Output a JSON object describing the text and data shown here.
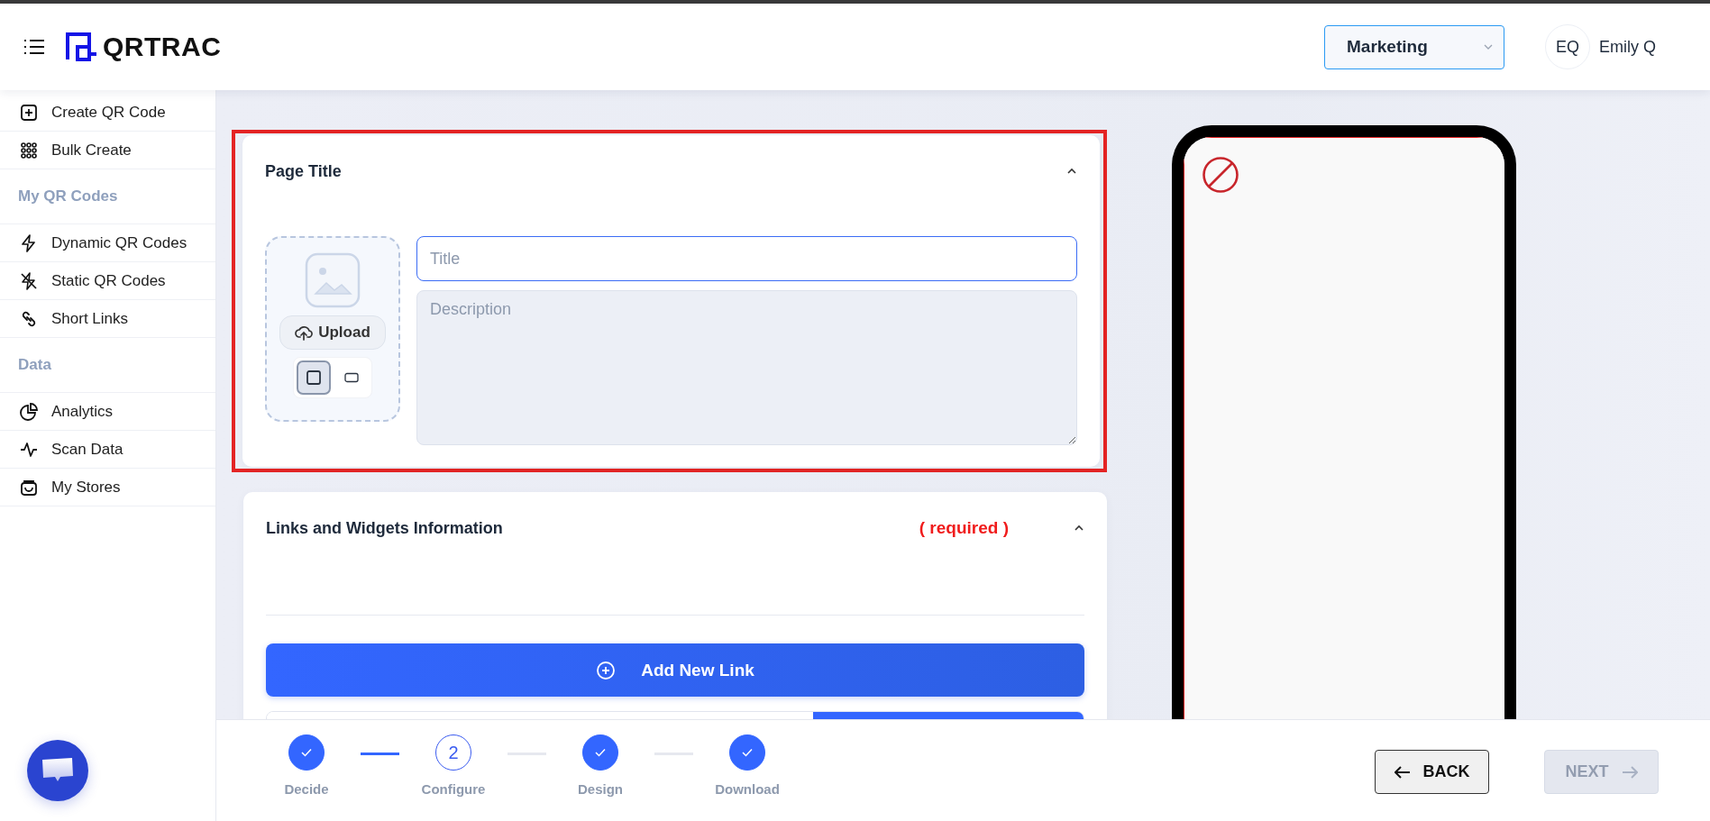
{
  "header": {
    "brand": "QRTRAC",
    "team_select": {
      "value": "Marketing"
    },
    "user": {
      "initials": "EQ",
      "name": "Emily Q"
    }
  },
  "sidebar": {
    "items": [
      {
        "kind": "item",
        "label": "Create QR Code"
      },
      {
        "kind": "item",
        "label": "Bulk Create"
      },
      {
        "kind": "heading",
        "label": "My QR Codes"
      },
      {
        "kind": "item",
        "label": "Dynamic QR Codes"
      },
      {
        "kind": "item",
        "label": "Static QR Codes"
      },
      {
        "kind": "item",
        "label": "Short Links"
      },
      {
        "kind": "heading",
        "label": "Data"
      },
      {
        "kind": "item",
        "label": "Analytics"
      },
      {
        "kind": "item",
        "label": "Scan Data"
      },
      {
        "kind": "item",
        "label": "My Stores"
      }
    ]
  },
  "page_title_card": {
    "title": "Page Title",
    "expanded": true,
    "upload_label": "Upload",
    "shape_options": [
      {
        "selected": true
      },
      {
        "selected": false
      }
    ],
    "title_field": {
      "placeholder": "Title",
      "focused": true
    },
    "description_field": {
      "placeholder": "Description"
    }
  },
  "links_card": {
    "title": "Links and Widgets Information",
    "required_note": "( required )",
    "expanded": true,
    "add_button": "Add New Link"
  },
  "stepper": {
    "steps": [
      {
        "label": "Decide",
        "completed": true,
        "selected": false
      },
      {
        "label": "Configure",
        "number": "2",
        "completed": false,
        "selected": true
      },
      {
        "label": "Design",
        "completed": true,
        "selected": false
      },
      {
        "label": "Download",
        "completed": true,
        "selected": false
      }
    ]
  },
  "buttons": {
    "back": {
      "label": "BACK"
    },
    "next": {
      "label": "NEXT",
      "disabled": true
    }
  }
}
